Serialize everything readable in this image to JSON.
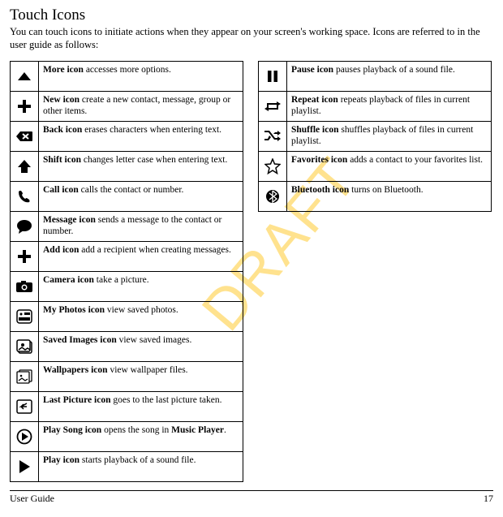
{
  "title": "Touch Icons",
  "intro": "You can touch icons to initiate actions when they appear on your screen's working space. Icons are referred to in the user guide as follows:",
  "watermark": "DRAFT",
  "footer_left": "User Guide",
  "footer_right": "17",
  "left_icons": [
    {
      "name": "More icon",
      "desc": " accesses more options."
    },
    {
      "name": "New icon",
      "desc": " create a new contact, message, group or other items."
    },
    {
      "name": "Back icon",
      "desc": " erases characters when entering text."
    },
    {
      "name": "Shift icon",
      "desc": " changes letter case when entering text."
    },
    {
      "name": "Call icon",
      "desc": " calls the contact or number."
    },
    {
      "name": "Message icon",
      "desc": " sends a message to the contact or number."
    },
    {
      "name": "Add icon",
      "desc": " add a recipient when creating messages."
    },
    {
      "name": "Camera icon",
      "desc": " take a picture."
    },
    {
      "name": "My Photos icon",
      "desc": " view saved photos."
    },
    {
      "name": "Saved Images icon",
      "desc": " view saved images."
    },
    {
      "name": "Wallpapers icon",
      "desc": " view wallpaper files."
    },
    {
      "name": "Last Picture icon",
      "desc": " goes to the last picture taken."
    },
    {
      "name": "Play Song icon",
      "desc_pre": " opens the song in ",
      "bold2": "Music Player",
      "desc_post": "."
    },
    {
      "name": "Play icon",
      "desc": " starts playback of a sound file."
    }
  ],
  "right_icons": [
    {
      "name": "Pause icon",
      "desc": " pauses playback of a sound file."
    },
    {
      "name": "Repeat icon",
      "desc": " repeats playback of files in current playlist."
    },
    {
      "name": "Shuffle icon",
      "desc": " shuffles playback of files in current playlist."
    },
    {
      "name": "Favorites icon",
      "desc": " adds a contact to your favorites list."
    },
    {
      "name": "Bluetooth icon",
      "desc": " turns on Bluetooth."
    }
  ]
}
